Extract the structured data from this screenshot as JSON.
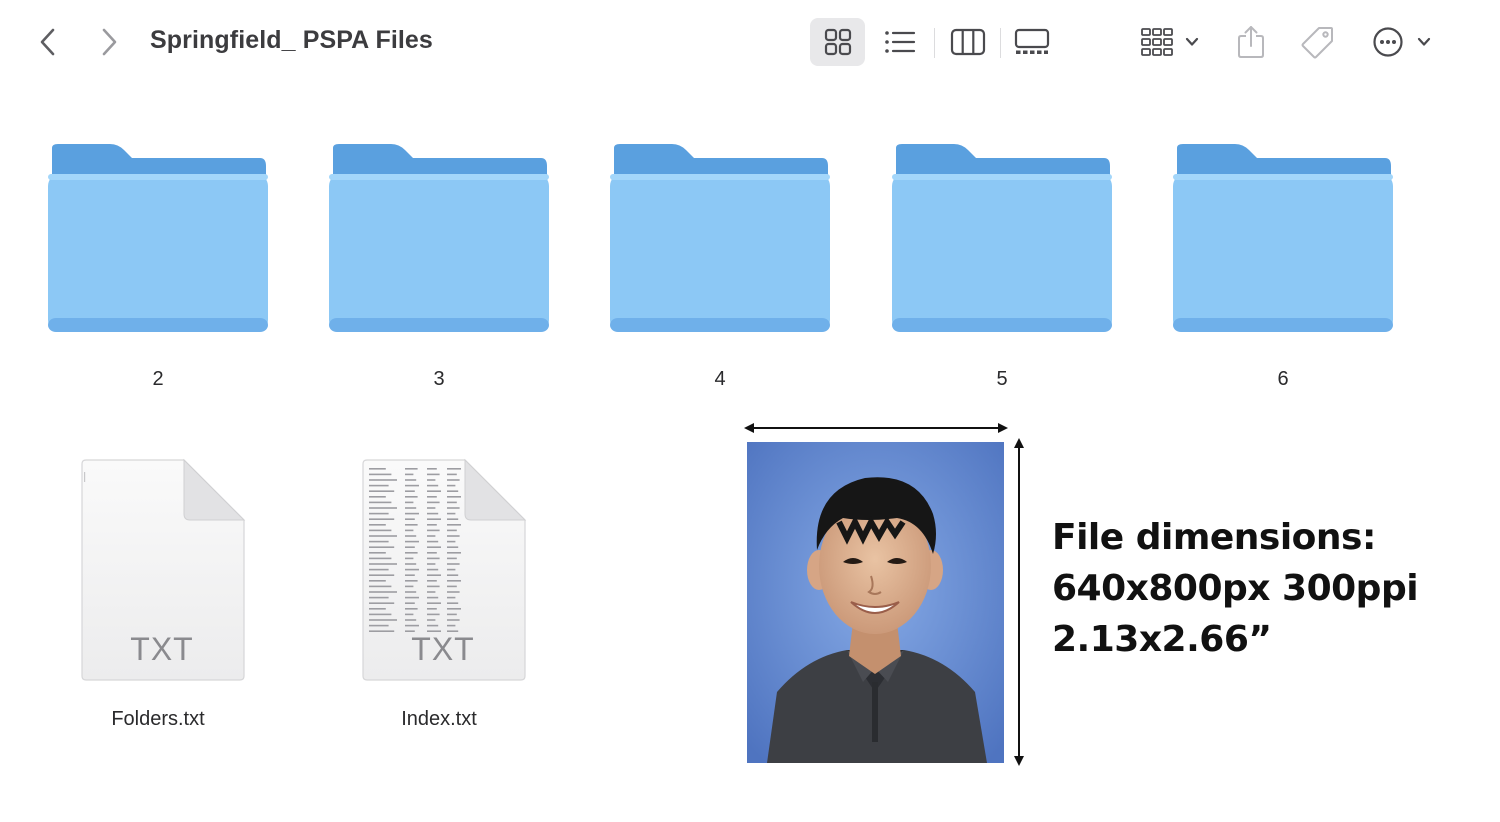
{
  "window": {
    "title": "Springfield_ PSPA Files"
  },
  "toolbar": {
    "back_icon": "chevron-left-icon",
    "forward_icon": "chevron-right-icon",
    "view_modes": [
      "icons",
      "list",
      "columns",
      "gallery"
    ],
    "active_view": "icons",
    "group_icon": "group-grid-icon",
    "share_icon": "share-icon",
    "tag_icon": "tag-icon",
    "more_icon": "ellipsis-circle-icon"
  },
  "folders": [
    {
      "name": "2"
    },
    {
      "name": "3"
    },
    {
      "name": "4"
    },
    {
      "name": "5"
    },
    {
      "name": "6"
    }
  ],
  "files": [
    {
      "name": "Folders.txt",
      "type_badge": "TXT"
    },
    {
      "name": "Index.txt",
      "type_badge": "TXT"
    }
  ],
  "annotation": {
    "line1": "File dimensions:",
    "line2": "640x800px 300ppi",
    "line3": "2.13x2.66”"
  },
  "colors": {
    "folder_front": "#8cc8f5",
    "folder_back": "#5aa0df",
    "accent_toolbar_bg": "#e8e8ea",
    "photo_background": "#6a90d8"
  }
}
